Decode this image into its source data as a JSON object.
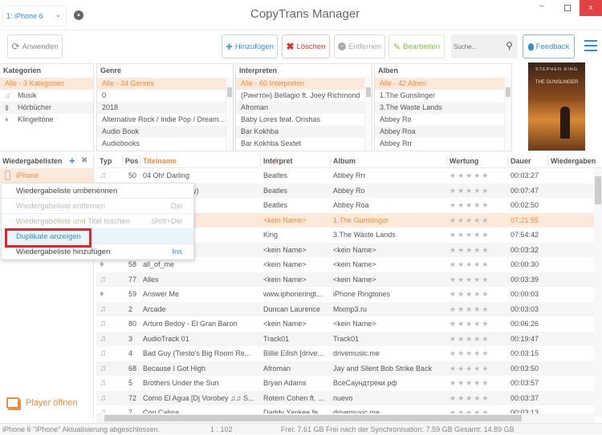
{
  "titlebar": {
    "device": "1: iPhone 6",
    "app_title": "CopyTrans Manager",
    "close": "x"
  },
  "toolbar": {
    "apply": "Anwenden",
    "add": "Hinzufügen",
    "delete": "Löschen",
    "remove": "Entfernen",
    "edit": "Bearbeiten",
    "search_placeholder": "Suche...",
    "feedback": "Feedback"
  },
  "colors": {
    "accent": "#f08a3c",
    "blue": "#2f8fd8",
    "delete": "#d9332b",
    "edit": "#8dbf3e",
    "close": "#e04343"
  },
  "panels": {
    "categories": {
      "title": "Kategorien",
      "items": [
        {
          "label": "Alle - 3 Kategorien",
          "icon": ""
        },
        {
          "label": "Musik",
          "icon": "music-note-icon"
        },
        {
          "label": "Hörbücher",
          "icon": "book-icon"
        },
        {
          "label": "Klingeltöne",
          "icon": "bell-icon"
        }
      ]
    },
    "genre": {
      "title": "Genre",
      "items": [
        "Alle - 34 Genres",
        "0",
        "2018",
        "Alternative Rock / Indie Pop / Dream...",
        "Audio Book",
        "Audiobooks"
      ]
    },
    "artists": {
      "title": "Interpreten",
      "items": [
        "Alle - 60 Interpreten",
        "(Рингтон) Bellagio ft. Joey Richmond",
        "Afroman",
        "Baby Lores feat. Orishas",
        "Bar Kokhba",
        "Bar Kokhba Sextet"
      ]
    },
    "albums": {
      "title": "Alben",
      "items": [
        "Alle - 42 Alben",
        "1.The Gunslinger",
        "3.The Waste Lands",
        "Abbey Ro",
        "Abbey Roa",
        "Abbey Rrr"
      ]
    },
    "cover": {
      "author": "STEPHEN KING",
      "book": "THE GUNSLINGER"
    }
  },
  "sidebar": {
    "title": "Wiedergabelisten",
    "playlist": "iPhone",
    "player": "Player öffnen"
  },
  "context_menu": [
    {
      "label": "Wiedergabeliste umbenennen",
      "shortcut": "",
      "disabled": false
    },
    {
      "label": "Wiedergabeliste entfernen",
      "shortcut": "Del",
      "disabled": true
    },
    {
      "label": "Wiedergabeliste und Titel löschen",
      "shortcut": "Shift+Del",
      "disabled": true
    },
    {
      "label": "Duplikate anzeigen",
      "shortcut": "",
      "disabled": false,
      "highlighted": true
    },
    {
      "label": "Wiedergabeliste hinzufügen",
      "shortcut": "Ins",
      "disabled": false
    }
  ],
  "table": {
    "columns": [
      "Typ",
      "Pos",
      "Titelname",
      "Interpret",
      "Album",
      "Wertung",
      "Dauer",
      "Wiedergaben"
    ],
    "sorted_column": "Titelname",
    "rows": [
      {
        "type": "music",
        "pos": "50",
        "title": "04 Oh! Darling",
        "artist": "Beatles",
        "album": "Abbey Rrr",
        "rating": 0,
        "duration": "00:03:27"
      },
      {
        "type": "music",
        "pos": "",
        "title": "(She's So Heavy)",
        "artist": "Beatles",
        "album": "Abbey Ro",
        "rating": 0,
        "duration": "00:07:47"
      },
      {
        "type": "music",
        "pos": "",
        "title": "Garden",
        "artist": "Beatles",
        "album": "Abbey Roa",
        "rating": 0,
        "duration": "00:02:50"
      },
      {
        "type": "book",
        "pos": "",
        "title": "ger",
        "artist": "<kein Name>",
        "album": "1.The Gunslinger",
        "rating": 0,
        "duration": "07:21:55",
        "selected": true
      },
      {
        "type": "book",
        "pos": "",
        "title": "ands, Part 2",
        "artist": "King",
        "album": "3.The Waste Lands",
        "rating": 0,
        "duration": "07:54:42"
      },
      {
        "type": "music",
        "pos": "",
        "title": "Faded",
        "artist": "<kein Name>",
        "album": "<kein Name>",
        "rating": 0,
        "duration": "00:03:32"
      },
      {
        "type": "ringtone",
        "pos": "58",
        "title": "all_of_me",
        "artist": "<kein Name>",
        "album": "<kein Name>",
        "rating": 0,
        "duration": "00:00:30"
      },
      {
        "type": "music",
        "pos": "77",
        "title": "Alles",
        "artist": "<kein Name>",
        "album": "<kein Name>",
        "rating": 0,
        "duration": "00:03:39"
      },
      {
        "type": "ringtone",
        "pos": "59",
        "title": "Answer Me",
        "artist": "www.iphoneringt...",
        "album": "iPhone Ringtones",
        "rating": 0,
        "duration": "00:00:03"
      },
      {
        "type": "music",
        "pos": "2",
        "title": "Arcade",
        "artist": "Duncan Laurence",
        "album": "Mixmp3.ru",
        "rating": 0,
        "duration": "00:03:03"
      },
      {
        "type": "music",
        "pos": "80",
        "title": "Arturo Bedoy - El Gran Baron",
        "artist": "<kein Name>",
        "album": "<kein Name>",
        "rating": 0,
        "duration": "00:06:26"
      },
      {
        "type": "music",
        "pos": "3",
        "title": "AudioTrack 01",
        "artist": "Track01",
        "album": "Track01",
        "rating": 0,
        "duration": "00:19:47"
      },
      {
        "type": "music",
        "pos": "4",
        "title": "Bad Guy (Tiesto's Big Room Re...",
        "artist": "Billie Eilish [drive...",
        "album": "drivemusic.me",
        "rating": 0,
        "duration": "00:03:15"
      },
      {
        "type": "music",
        "pos": "68",
        "title": "Because I Got High",
        "artist": "Afroman",
        "album": "Jay and Silent Bob Strike Back",
        "rating": 0,
        "duration": "00:03:50"
      },
      {
        "type": "music",
        "pos": "5",
        "title": "Brothers Under the Sun",
        "artist": "Bryan Adams",
        "album": "ВсеСаундтреки.рф",
        "rating": 0,
        "duration": "00:03:57"
      },
      {
        "type": "music",
        "pos": "72",
        "title": "Como El Agua [Dj Vorobey ♫♫ S...",
        "artist": "Rotem Cohen ft. ...",
        "album": "nuevo",
        "rating": 0,
        "duration": "00:03:37"
      },
      {
        "type": "music",
        "pos": "7",
        "title": "Con Calma",
        "artist": "Daddy Yankee fe...",
        "album": "drivemusic.me",
        "rating": 0,
        "duration": "00:03:13"
      }
    ]
  },
  "status": {
    "message": "iPhone 6 \"iPhone\" Aktualisierung abgeschlossen.",
    "position": "1 : 102",
    "storage": "Frei: 7.61 GB Frei nach der Synchronisation: 7.59 GB Gesamt: 14.89 GB"
  }
}
